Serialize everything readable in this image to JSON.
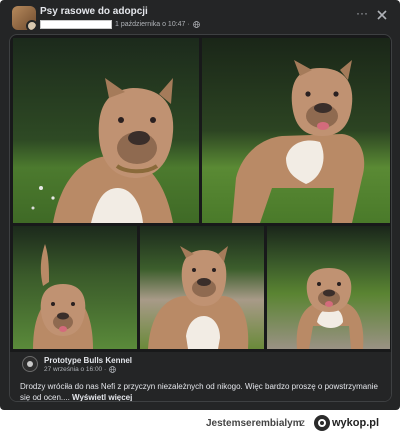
{
  "post": {
    "group_name": "Psy rasowe do adopcji",
    "timestamp": "1 października o 10:47 ·",
    "more_label": "···"
  },
  "shared_post": {
    "page_name": "Prototype Bulls Kennel",
    "timestamp": "27 września o 16:00 ·",
    "text": "Drodzy wróciła do nas Nefi z przyczyn niezależnych od nikogo. Więc bardzo proszę o powstrzymanie się od ocen.... ",
    "see_more": "Wyświetl więcej"
  },
  "watermark": {
    "user": "Jestemserembialym",
    "separator": "z",
    "site": "wykop.pl"
  },
  "colors": {
    "card_bg": "#242526",
    "text_primary": "#e4e6eb",
    "text_secondary": "#b0b3b8",
    "dog_coat": "#b98a66",
    "dog_chest": "#f2ece4",
    "grass": "#4f7a2e"
  },
  "icons": [
    "globe-icon",
    "more-icon",
    "close-icon"
  ]
}
